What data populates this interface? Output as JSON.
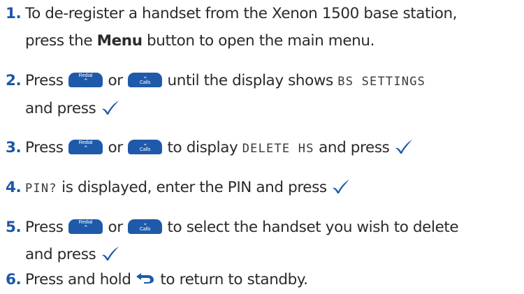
{
  "keys": {
    "redial_label": "Redial",
    "calls_label": "Calls",
    "up_arrow": "⌃",
    "down_arrow": "⌄"
  },
  "icons": {
    "redial_key": "redial-up-key-icon",
    "calls_key": "calls-down-key-icon",
    "confirm": "check-icon",
    "back": "back-arrow-icon"
  },
  "colors": {
    "step_number": "#1c56a8",
    "key_fill": "#1f5aaa",
    "text": "#2a2a2a"
  },
  "steps": [
    {
      "number": "1.",
      "line1": "To de-register a handset from the Xenon 1500 base station,",
      "line2_pre": "press the ",
      "line2_bold": "Menu",
      "line2_post": " button to open the main menu."
    },
    {
      "number": "2.",
      "pre": "Press ",
      "or": " or ",
      "mid": " until the display shows ",
      "lcd": "BS SETTINGS",
      "line2": "and press "
    },
    {
      "number": "3.",
      "pre": "Press ",
      "or": " or ",
      "mid": " to display ",
      "lcd": "DELETE HS",
      "post": " and press "
    },
    {
      "number": "4.",
      "lcd": "PIN?",
      "text": " is displayed, enter the PIN and press "
    },
    {
      "number": "5.",
      "pre": "Press ",
      "or": " or ",
      "mid": " to select the handset you wish to delete",
      "line2": "and press "
    },
    {
      "number": "6.",
      "pre": "Press and hold ",
      "post": " to return to standby."
    }
  ]
}
